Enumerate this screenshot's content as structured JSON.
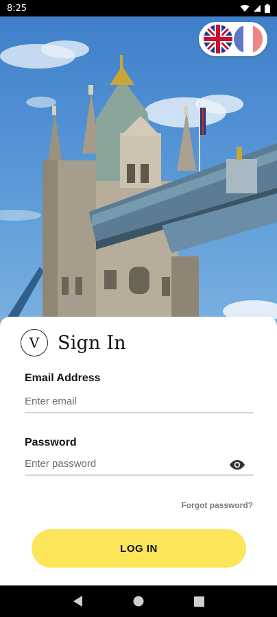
{
  "status_bar": {
    "time": "8:25"
  },
  "language_switcher": {
    "options": [
      "English",
      "French"
    ]
  },
  "signin": {
    "logo_letter": "V",
    "title": "Sign In",
    "email_label": "Email Address",
    "email_placeholder": "Enter email",
    "email_value": "",
    "password_label": "Password",
    "password_placeholder": "Enter password",
    "password_value": "",
    "forgot_label": "Forgot password?",
    "login_label": "LOG IN"
  },
  "colors": {
    "accent": "#fde55a",
    "sky": "#4f8fd3",
    "card_bg": "#ffffff"
  },
  "icons": [
    "wifi-icon",
    "signal-icon",
    "battery-icon",
    "eye-icon",
    "back-icon",
    "home-icon",
    "recents-icon"
  ]
}
